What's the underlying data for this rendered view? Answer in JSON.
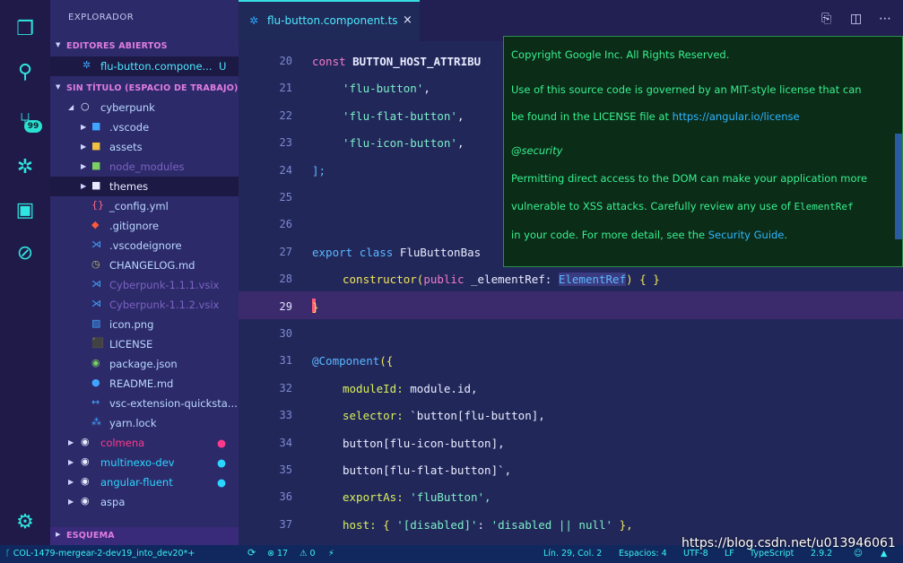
{
  "tab": {
    "label": "flu-button.component.ts",
    "close": "×"
  },
  "tab_actions": [
    "⎘",
    "◫",
    "⋯"
  ],
  "sidebar": {
    "title": "EXPLORADOR",
    "open_editors_header": "EDITORES ABIERTOS",
    "open_file": {
      "label": "flu-button.compone...",
      "badge": "U"
    },
    "workspace_header": "SIN TÍTULO (ESPACIO DE TRABAJO)",
    "items": [
      {
        "label": "cyberpunk"
      },
      {
        "label": ".vscode"
      },
      {
        "label": "assets"
      },
      {
        "label": "node_modules"
      },
      {
        "label": "themes"
      },
      {
        "label": "_config.yml"
      },
      {
        "label": ".gitignore"
      },
      {
        "label": ".vscodeignore"
      },
      {
        "label": "CHANGELOG.md"
      },
      {
        "label": "Cyberpunk-1.1.1.vsix"
      },
      {
        "label": "Cyberpunk-1.1.2.vsix"
      },
      {
        "label": "icon.png"
      },
      {
        "label": "LICENSE"
      },
      {
        "label": "package.json"
      },
      {
        "label": "README.md"
      },
      {
        "label": "vsc-extension-quicksta..."
      },
      {
        "label": "yarn.lock"
      },
      {
        "label": "colmena"
      },
      {
        "label": "multinexo-dev"
      },
      {
        "label": "angular-fluent"
      },
      {
        "label": "aspa"
      }
    ],
    "outline_header": "ESQUEMA"
  },
  "activity_badge": "99",
  "editor": {
    "line_numbers": [
      "20",
      "21",
      "22",
      "23",
      "24",
      "25",
      "26",
      "27",
      "28",
      "29",
      "30",
      "31",
      "32",
      "33",
      "34",
      "35",
      "36",
      "37"
    ],
    "current_line": "29"
  },
  "code": {
    "l20_a": "const ",
    "l20_b": "BUTTON_HOST_ATTRIBU",
    "l21": "'flu-button'",
    "l22": "'flu-flat-button'",
    "l23": "'flu-icon-button'",
    "l24": "];",
    "l27_a": "export ",
    "l27_b": "class ",
    "l27_c": "FluButtonBas",
    "l28_a": "constructor(",
    "l28_b": "public ",
    "l28_c": "_elementRef: ",
    "l28_d": "ElementRef",
    "l28_e": ") { }",
    "l29": "}",
    "l31_a": "@Component",
    "l31_b": "({",
    "l32_a": "moduleId: ",
    "l32_b": "module.id,",
    "l33_a": "selector: ",
    "l33_b": "`button[flu-button],",
    "l34": "button[flu-icon-button],",
    "l35": "button[flu-flat-button]`,",
    "l36_a": "exportAs: ",
    "l36_b": "'fluButton',",
    "l37_a": "host: ",
    "l37_b": "{ ",
    "l37_c": "'[disabled]'",
    "l37_d": ": ",
    "l37_e": "'disabled || null'",
    "l37_f": " },"
  },
  "tooltip": {
    "l1": "Copyright Google Inc. All Rights Reserved.",
    "l2": "Use of this source code is governed by an MIT-style license that can",
    "l3a": "be found in the LICENSE file at ",
    "l3b": "https://angular.io/license",
    "l4": "@security",
    "l5": "Permitting direct access to the DOM can make your application more",
    "l6a": "vulnerable to XSS attacks. Carefully review any use of ",
    "l6b": "ElementRef",
    "l7a": "in your code. For more detail, see the ",
    "l7b": "Security Guide",
    "l7c": "."
  },
  "statusbar": {
    "branch": "COL-1479-mergear-2-dev19_into_dev20*+",
    "sync": "⟳",
    "errors": "⊗ 17",
    "warnings": "⚠ 0",
    "bolt": "⚡",
    "position": "Lín. 29, Col. 2",
    "spaces": "Espacios: 4",
    "encoding": "UTF-8",
    "eol": "LF",
    "language": "TypeScript",
    "version": "2.9.2"
  },
  "watermark": "https://blog.csdn.net/u013946061"
}
